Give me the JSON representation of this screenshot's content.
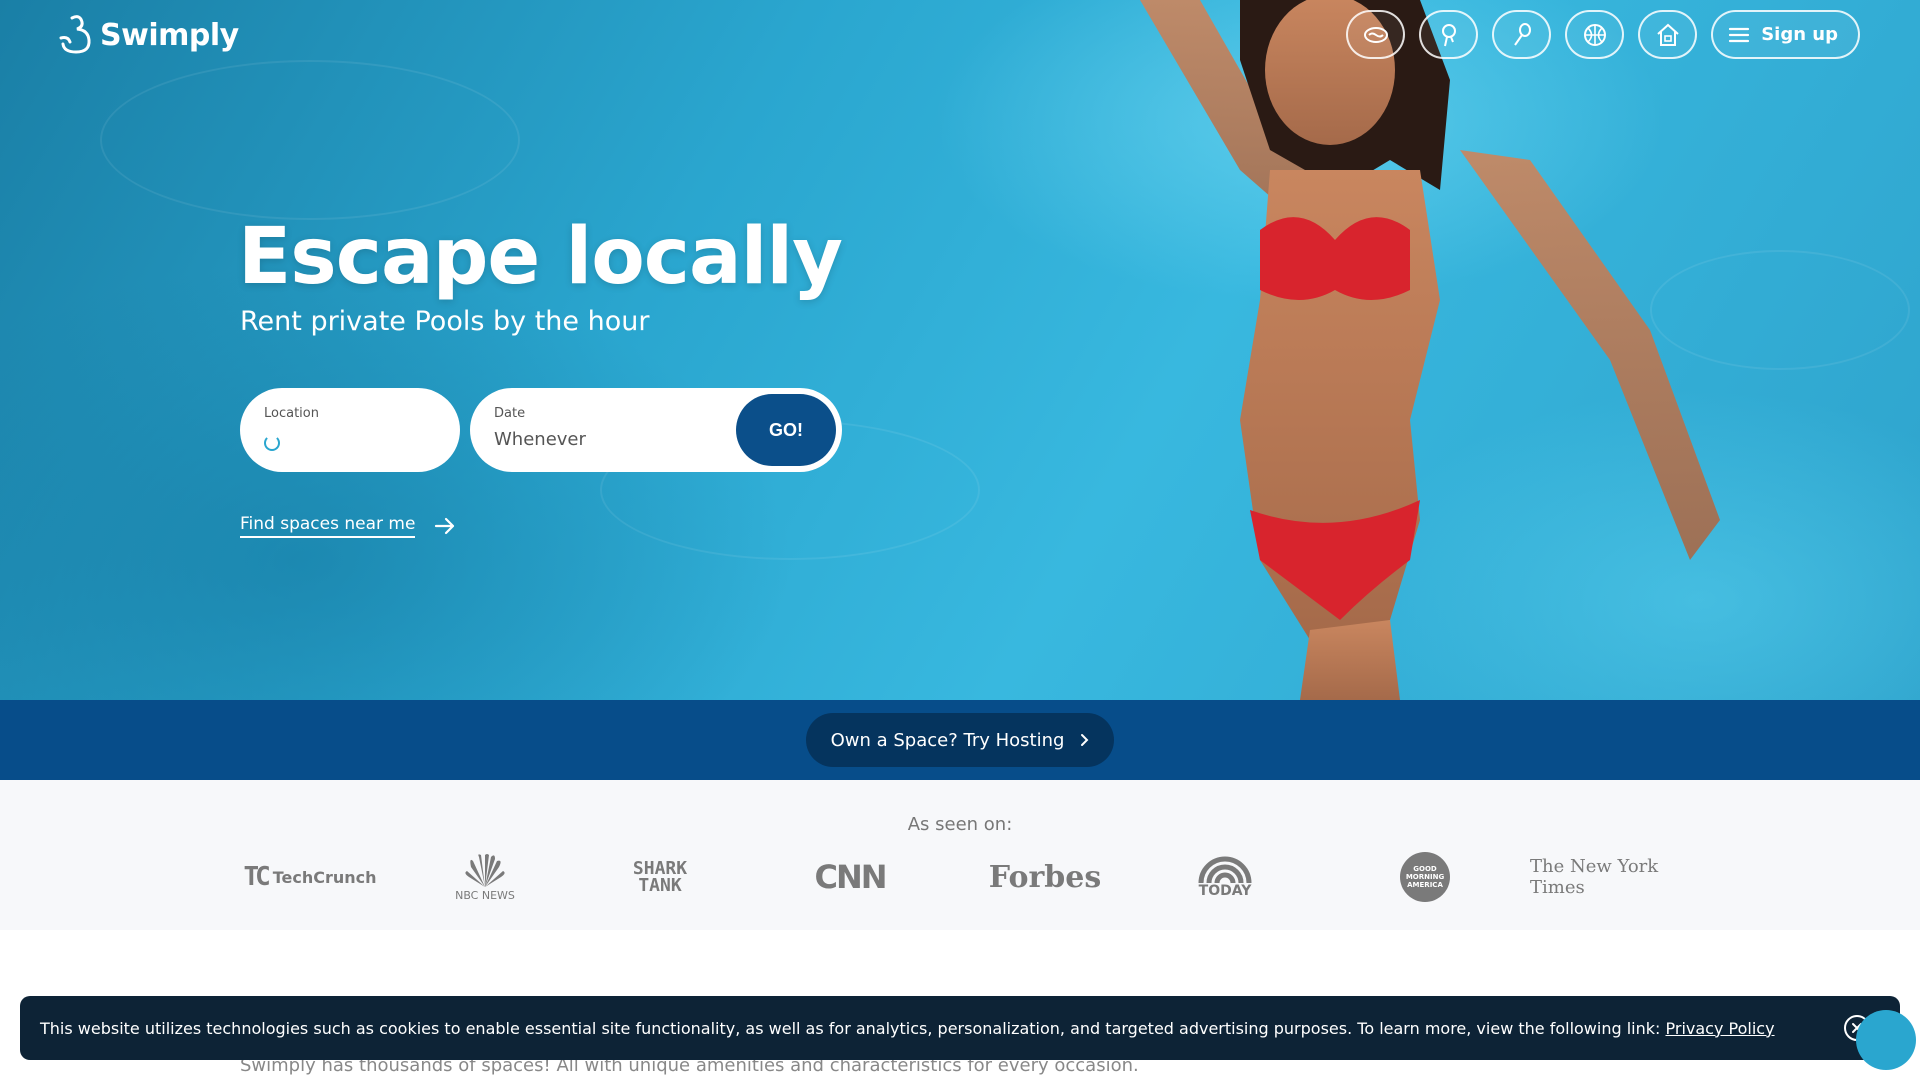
{
  "brand": {
    "name": "Swimply"
  },
  "nav": {
    "icons": [
      "pool-icon",
      "court-icon",
      "event-icon",
      "sport-icon",
      "home-icon"
    ],
    "signup_label": "Sign up"
  },
  "hero": {
    "headline": "Escape locally",
    "subhead": "Rent private Pools by the hour",
    "location_label": "Location",
    "date_label": "Date",
    "date_value": "Whenever",
    "go_label": "GO!",
    "near_me_label": "Find spaces near me"
  },
  "host": {
    "label": "Own a Space? Try Hosting"
  },
  "press": {
    "title": "As seen on:",
    "techcrunch": "TechCrunch",
    "techcrunch_mark": "TC",
    "nbc": "NBC NEWS",
    "shark_1": "SHARK",
    "shark_2": "TANK",
    "cnn": "CNN",
    "forbes": "Forbes",
    "today": "TODAY",
    "gma": "GOOD MORNING AMERICA",
    "nyt": "The New York Times"
  },
  "spaces_text": "Swimply has thousands of spaces! All with unique amenities and characteristics for every occasion.",
  "cookie": {
    "text": "This website utilizes technologies such as cookies to enable essential site functionality, as well as for analytics, personalization, and targeted advertising purposes. To learn more, view the following link: ",
    "link": "Privacy Policy"
  },
  "colors": {
    "primary": "#074d8a",
    "go_button": "#0b4f8a",
    "host_button": "#05345e",
    "cookie_bg": "#0d2336",
    "pool": "#2aa6cf"
  }
}
